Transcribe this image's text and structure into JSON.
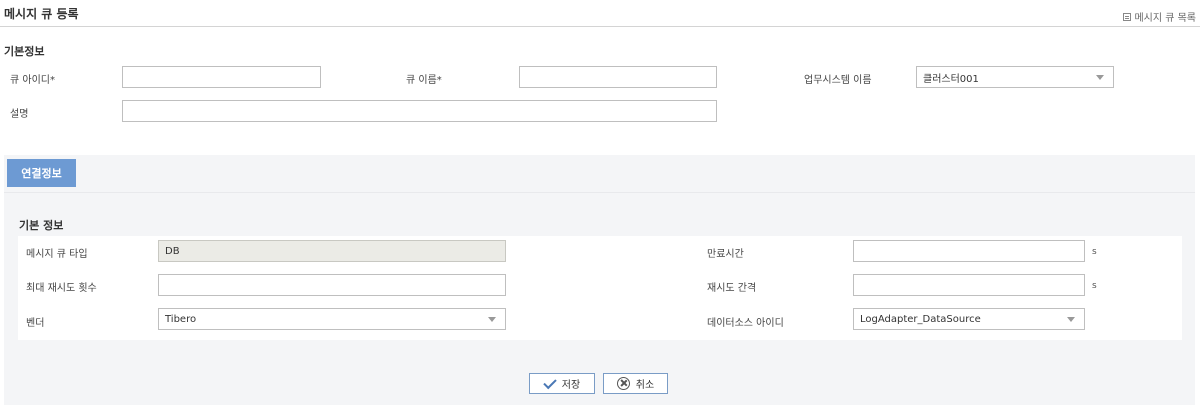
{
  "header": {
    "title": "메시지 큐 등록",
    "list_link": "메시지 큐 목록"
  },
  "basic_info": {
    "title": "기본정보",
    "queue_id_label": "큐 아이디*",
    "queue_id_value": "",
    "queue_name_label": "큐 이름*",
    "queue_name_value": "",
    "business_system_label": "업무시스템 이름",
    "business_system_value": "클러스터001",
    "description_label": "설명",
    "description_value": ""
  },
  "connection": {
    "tab_label": "연결정보",
    "section_title": "기본 정보",
    "queue_type_label": "메시지 큐 타입",
    "queue_type_value": "DB",
    "expire_label": "만료시간",
    "expire_value": "",
    "expire_unit": "s",
    "max_retry_label": "최대 재시도 횟수",
    "max_retry_value": "",
    "retry_interval_label": "재시도 간격",
    "retry_interval_value": "",
    "retry_interval_unit": "s",
    "vendor_label": "벤더",
    "vendor_value": "Tibero",
    "datasource_label": "데이터소스 아이디",
    "datasource_value": "LogAdapter_DataSource"
  },
  "actions": {
    "save_label": "저장",
    "cancel_label": "취소"
  }
}
